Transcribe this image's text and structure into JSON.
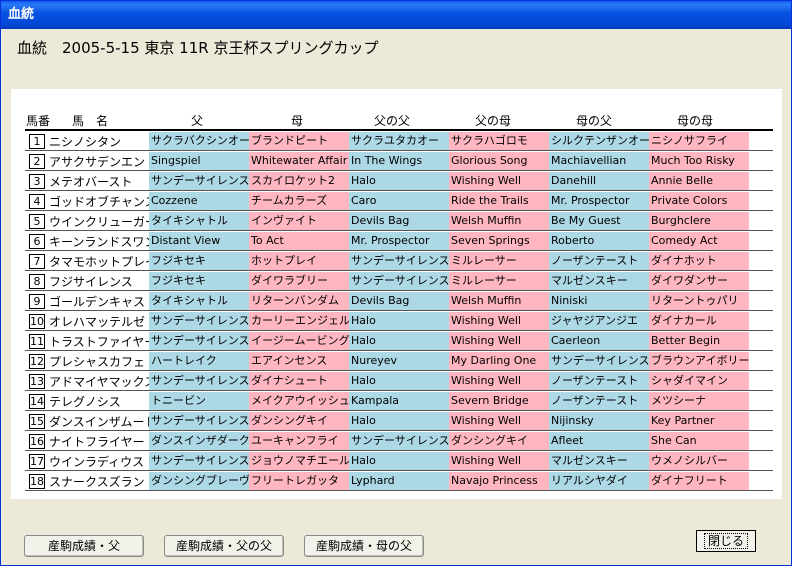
{
  "window": {
    "title": "血統"
  },
  "header": {
    "text": "血統　2005-5-15 東京 11R 京王杯スプリングカップ"
  },
  "table": {
    "columns": [
      "馬番",
      "馬　名",
      "父",
      "母",
      "父の父",
      "父の母",
      "母の父",
      "母の母"
    ],
    "rows": [
      {
        "no": "1",
        "horse": "ニシノシタン",
        "sire": "サクラバクシンオー",
        "dam": "ブランドピート",
        "ss": "サクラユタカオー",
        "sd": "サクラハゴロモ",
        "ds": "シルクテンザンオー",
        "dd": "ニシノサフライ"
      },
      {
        "no": "2",
        "horse": "アサクサデンエン",
        "sire": "Singspiel",
        "dam": "Whitewater Affair",
        "ss": "In The Wings",
        "sd": "Glorious Song",
        "ds": "Machiavellian",
        "dd": "Much Too Risky"
      },
      {
        "no": "3",
        "horse": "メテオバースト",
        "sire": "サンデーサイレンス",
        "dam": "スカイロケット2",
        "ss": "Halo",
        "sd": "Wishing Well",
        "ds": "Danehill",
        "dd": "Annie Belle"
      },
      {
        "no": "4",
        "horse": "ゴッドオブチャンス",
        "sire": "Cozzene",
        "dam": "チームカラーズ",
        "ss": "Caro",
        "sd": "Ride the Trails",
        "ds": "Mr. Prospector",
        "dd": "Private Colors"
      },
      {
        "no": "5",
        "horse": "ウインクリューガー",
        "sire": "タイキシャトル",
        "dam": "インヴァイト",
        "ss": "Devils Bag",
        "sd": "Welsh Muffin",
        "ds": "Be My Guest",
        "dd": "Burghclere"
      },
      {
        "no": "6",
        "horse": "キーンランドスワン",
        "sire": "Distant View",
        "dam": "To Act",
        "ss": "Mr. Prospector",
        "sd": "Seven Springs",
        "ds": "Roberto",
        "dd": "Comedy Act"
      },
      {
        "no": "7",
        "horse": "タマモホットプレイ",
        "sire": "フジキセキ",
        "dam": "ホットプレイ",
        "ss": "サンデーサイレンス",
        "sd": "ミルレーサー",
        "ds": "ノーザンテースト",
        "dd": "ダイナホット"
      },
      {
        "no": "8",
        "horse": "フジサイレンス",
        "sire": "フジキセキ",
        "dam": "ダイワラブリー",
        "ss": "サンデーサイレンス",
        "sd": "ミルレーサー",
        "ds": "マルゼンスキー",
        "dd": "ダイワダンサー"
      },
      {
        "no": "9",
        "horse": "ゴールデンキャスト",
        "sire": "タイキシャトル",
        "dam": "リターンバンダム",
        "ss": "Devils Bag",
        "sd": "Welsh Muffin",
        "ds": "Niniski",
        "dd": "リターントゥパリ"
      },
      {
        "no": "10",
        "horse": "オレハマッテルゼ",
        "sire": "サンデーサイレンス",
        "dam": "カーリーエンジェル",
        "ss": "Halo",
        "sd": "Wishing Well",
        "ds": "ジャヤジアンジエ",
        "dd": "ダイナカール"
      },
      {
        "no": "11",
        "horse": "トラストファイヤー",
        "sire": "サンデーサイレンス",
        "dam": "イージームービング",
        "ss": "Halo",
        "sd": "Wishing Well",
        "ds": "Caerleon",
        "dd": "Better Begin"
      },
      {
        "no": "12",
        "horse": "プレシャスカフェ",
        "sire": "ハートレイク",
        "dam": "エアインセンス",
        "ss": "Nureyev",
        "sd": "My Darling One",
        "ds": "サンデーサイレンス",
        "dd": "ブラウンアイボリー"
      },
      {
        "no": "13",
        "horse": "アドマイヤマックス",
        "sire": "サンデーサイレンス",
        "dam": "ダイナシュート",
        "ss": "Halo",
        "sd": "Wishing Well",
        "ds": "ノーザンテースト",
        "dd": "シャダイマイン"
      },
      {
        "no": "14",
        "horse": "テレグノシス",
        "sire": "トニービン",
        "dam": "メイクアウイッシュ",
        "ss": "Kampala",
        "sd": "Severn Bridge",
        "ds": "ノーザンテースト",
        "dd": "メツシーナ"
      },
      {
        "no": "15",
        "horse": "ダンスインザムード",
        "sire": "サンデーサイレンス",
        "dam": "ダンシングキイ",
        "ss": "Halo",
        "sd": "Wishing Well",
        "ds": "Nijinsky",
        "dd": "Key Partner"
      },
      {
        "no": "16",
        "horse": "ナイトフライヤー",
        "sire": "ダンスインザダーク",
        "dam": "ユーキャンフライ",
        "ss": "サンデーサイレンス",
        "sd": "ダンシングキイ",
        "ds": "Afleet",
        "dd": "She Can"
      },
      {
        "no": "17",
        "horse": "ウインラディウス",
        "sire": "サンデーサイレンス",
        "dam": "ジョウノマチエール",
        "ss": "Halo",
        "sd": "Wishing Well",
        "ds": "マルゼンスキー",
        "dd": "ウメノシルバー"
      },
      {
        "no": "18",
        "horse": "スナークスズラン",
        "sire": "ダンシングブレーヴ",
        "dam": "フリートレガッタ",
        "ss": "Lyphard",
        "sd": "Navajo Princess",
        "ds": "リアルシヤダイ",
        "dd": "ダイナフリート"
      }
    ]
  },
  "buttons": {
    "sire_results": "産駒成績・父",
    "sire_sire_results": "産駒成績・父の父",
    "dam_sire_results": "産駒成績・母の父",
    "close": "閉じる"
  },
  "colors": {
    "sire_side": "#add8e6",
    "dam_side": "#ffb6c1"
  }
}
